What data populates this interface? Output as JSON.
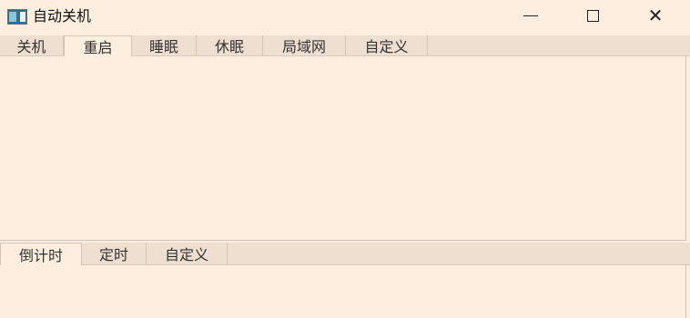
{
  "window": {
    "title": "自动关机",
    "controls": {
      "minimize": "—",
      "maximize": "☐",
      "close": "✕"
    }
  },
  "top_tabs": {
    "active": "重启",
    "items": [
      "关机",
      "重启",
      "睡眠",
      "休眠",
      "局域网",
      "自定义"
    ]
  },
  "bottom_tabs": {
    "active": "倒计时",
    "items": [
      "倒计时",
      "定时",
      "自定义"
    ]
  },
  "icons": {
    "app": "window-app-icon"
  },
  "colors": {
    "background": "#fdeedf",
    "tabbar": "#eedfd1"
  }
}
